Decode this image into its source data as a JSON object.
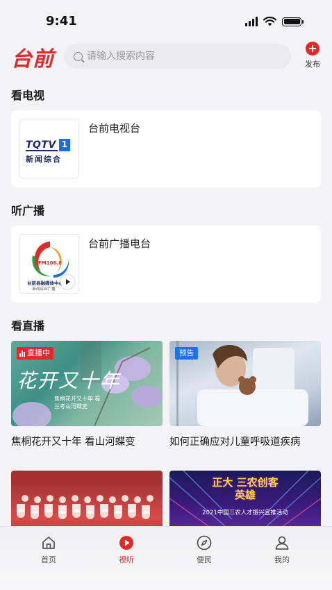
{
  "status_bar": {
    "time": "9:41"
  },
  "header": {
    "logo": "台前",
    "search_placeholder": "请输入搜索内容",
    "publish_label": "发布"
  },
  "sections": {
    "tv_title": "看电视",
    "radio_title": "听广播",
    "live_title": "看直播"
  },
  "tv_card": {
    "title": "台前电视台",
    "logo_text": "TQTV",
    "logo_channel": "1",
    "logo_subtitle": "新闻综合"
  },
  "radio_card": {
    "title": "台前广播电台",
    "logo_freq": "FM106.8",
    "logo_name": "台前县融媒体中心",
    "logo_sub": "新闻综合广播"
  },
  "live_items": [
    {
      "badge": "直播中",
      "badge_type": "live",
      "caption": "焦桐花开又十年 看山河蝶变",
      "image_text": "花开又十年",
      "image_sub": "焦桐花开又十年 看兰考山河蝶变"
    },
    {
      "badge": "预告",
      "badge_type": "preview",
      "caption": "如何正确应对儿童呼吸道疾病"
    },
    {
      "badge": "",
      "caption": ""
    },
    {
      "badge": "",
      "caption": "",
      "image_text": "正大 三农创客英雄",
      "image_sub": "2021中国三农人才振兴宣推活动"
    }
  ],
  "tabbar": [
    {
      "label": "首页",
      "icon": "home-icon",
      "active": false
    },
    {
      "label": "视听",
      "icon": "play-icon",
      "active": true
    },
    {
      "label": "便民",
      "icon": "compass-icon",
      "active": false
    },
    {
      "label": "我的",
      "icon": "user-icon",
      "active": false
    }
  ],
  "colors": {
    "brand": "#e02a2a",
    "preview": "#1a73e8",
    "background": "#f4f4f6"
  }
}
